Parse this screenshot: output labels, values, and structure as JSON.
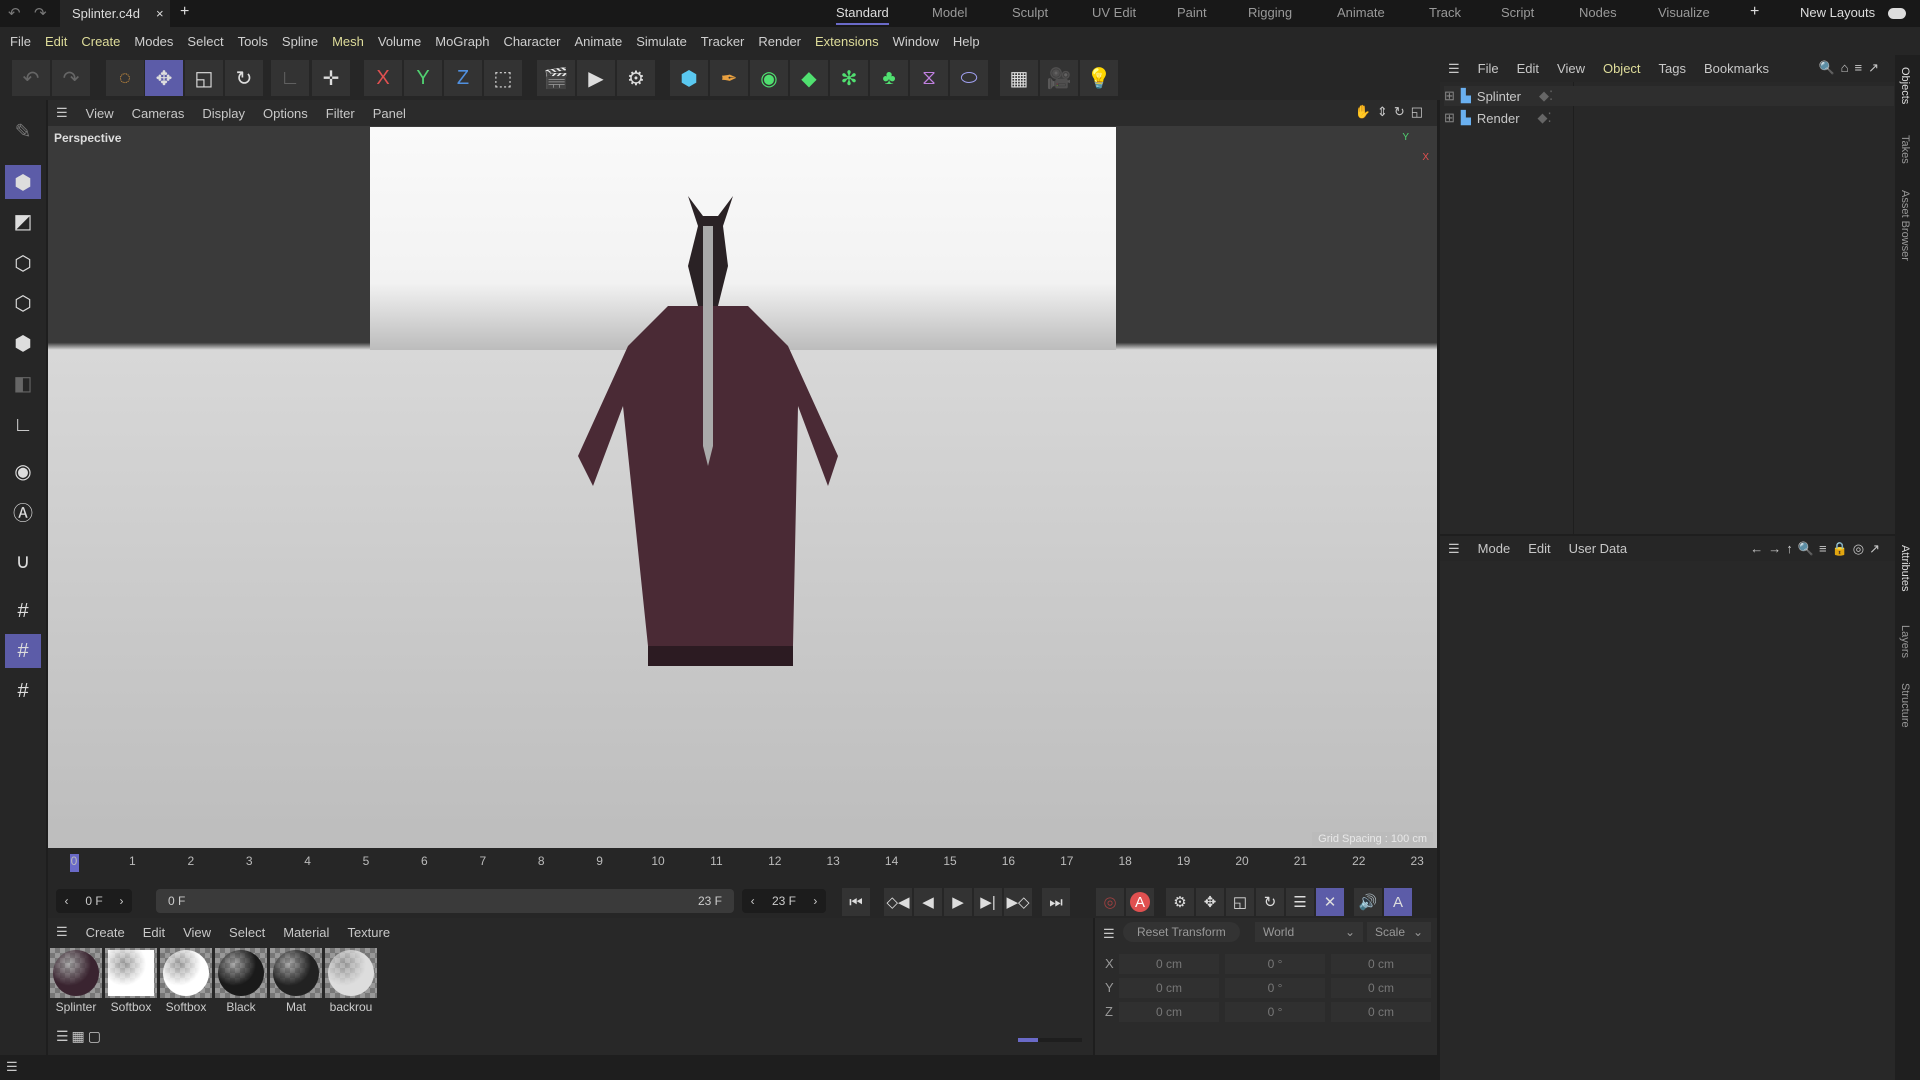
{
  "titlebar": {
    "document": "Splinter.c4d",
    "close": "×",
    "add": "+",
    "layouts": [
      "Standard",
      "Model",
      "Sculpt",
      "UV Edit",
      "Paint",
      "Rigging",
      "Animate",
      "Track",
      "Script",
      "Nodes",
      "Visualize"
    ],
    "add_layout": "+",
    "new_layouts": "New Layouts"
  },
  "menubar": [
    "File",
    "Edit",
    "Create",
    "Modes",
    "Select",
    "Tools",
    "Spline",
    "Mesh",
    "Volume",
    "MoGraph",
    "Character",
    "Animate",
    "Simulate",
    "Tracker",
    "Render",
    "Extensions",
    "Window",
    "Help"
  ],
  "toolbar": {
    "x": "X",
    "y": "Y",
    "z": "Z"
  },
  "viewport": {
    "menu": [
      "View",
      "Cameras",
      "Display",
      "Options",
      "Filter",
      "Panel"
    ],
    "label": "Perspective",
    "grid_spacing": "Grid Spacing : 100 cm",
    "axis_y": "Y",
    "axis_x": "X"
  },
  "timeline": {
    "ticks": [
      "0",
      "1",
      "2",
      "3",
      "4",
      "5",
      "6",
      "7",
      "8",
      "9",
      "10",
      "11",
      "12",
      "13",
      "14",
      "15",
      "16",
      "17",
      "18",
      "19",
      "20",
      "21",
      "22",
      "23"
    ],
    "current": "0 F",
    "range_start": "0 F",
    "range_end": "23 F",
    "end": "23 F"
  },
  "materials": {
    "menu": [
      "Create",
      "Edit",
      "View",
      "Select",
      "Material",
      "Texture"
    ],
    "items": [
      {
        "name": "Splinter",
        "color": "#3a2430"
      },
      {
        "name": "Softbox",
        "color": "#ffffff"
      },
      {
        "name": "Softbox",
        "color": "#ffffff"
      },
      {
        "name": "Black",
        "color": "#1a1a1a"
      },
      {
        "name": "Mat",
        "color": "#222222"
      },
      {
        "name": "backrou",
        "color": "#dddddd"
      }
    ]
  },
  "coords": {
    "reset": "Reset Transform",
    "space": "World",
    "mode": "Scale",
    "rows": [
      {
        "axis": "X",
        "pos": "0 cm",
        "rot": "0 °",
        "scale": "0 cm"
      },
      {
        "axis": "Y",
        "pos": "0 cm",
        "rot": "0 °",
        "scale": "0 cm"
      },
      {
        "axis": "Z",
        "pos": "0 cm",
        "rot": "0 °",
        "scale": "0 cm"
      }
    ]
  },
  "objects": {
    "menu": [
      "File",
      "Edit",
      "View",
      "Object",
      "Tags",
      "Bookmarks"
    ],
    "items": [
      "Splinter",
      "Render"
    ]
  },
  "attributes": {
    "menu": [
      "Mode",
      "Edit",
      "User Data"
    ]
  },
  "side_tabs": [
    "Objects",
    "Takes",
    "Asset Browser",
    "Attributes",
    "Layers",
    "Structure"
  ],
  "accent": "#5c5ca8"
}
